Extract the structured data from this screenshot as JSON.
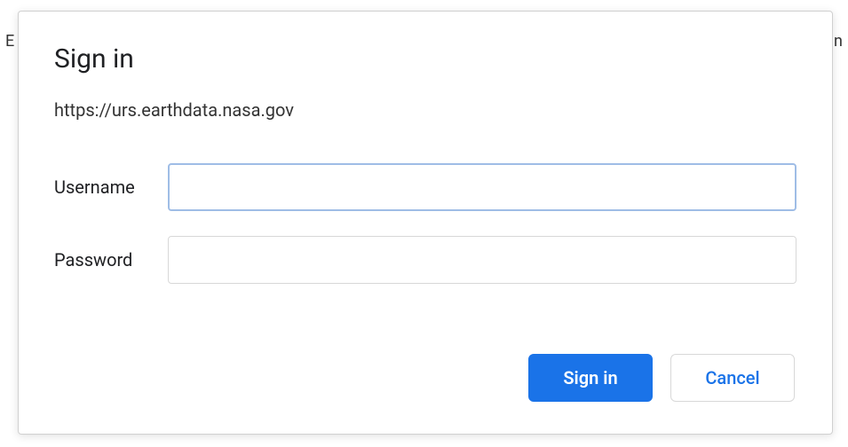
{
  "background": {
    "left_fragment": "E",
    "right_fragment": "n"
  },
  "dialog": {
    "title": "Sign in",
    "origin": "https://urs.earthdata.nasa.gov",
    "username": {
      "label": "Username",
      "value": ""
    },
    "password": {
      "label": "Password",
      "value": ""
    },
    "buttons": {
      "primary": "Sign in",
      "secondary": "Cancel"
    }
  }
}
